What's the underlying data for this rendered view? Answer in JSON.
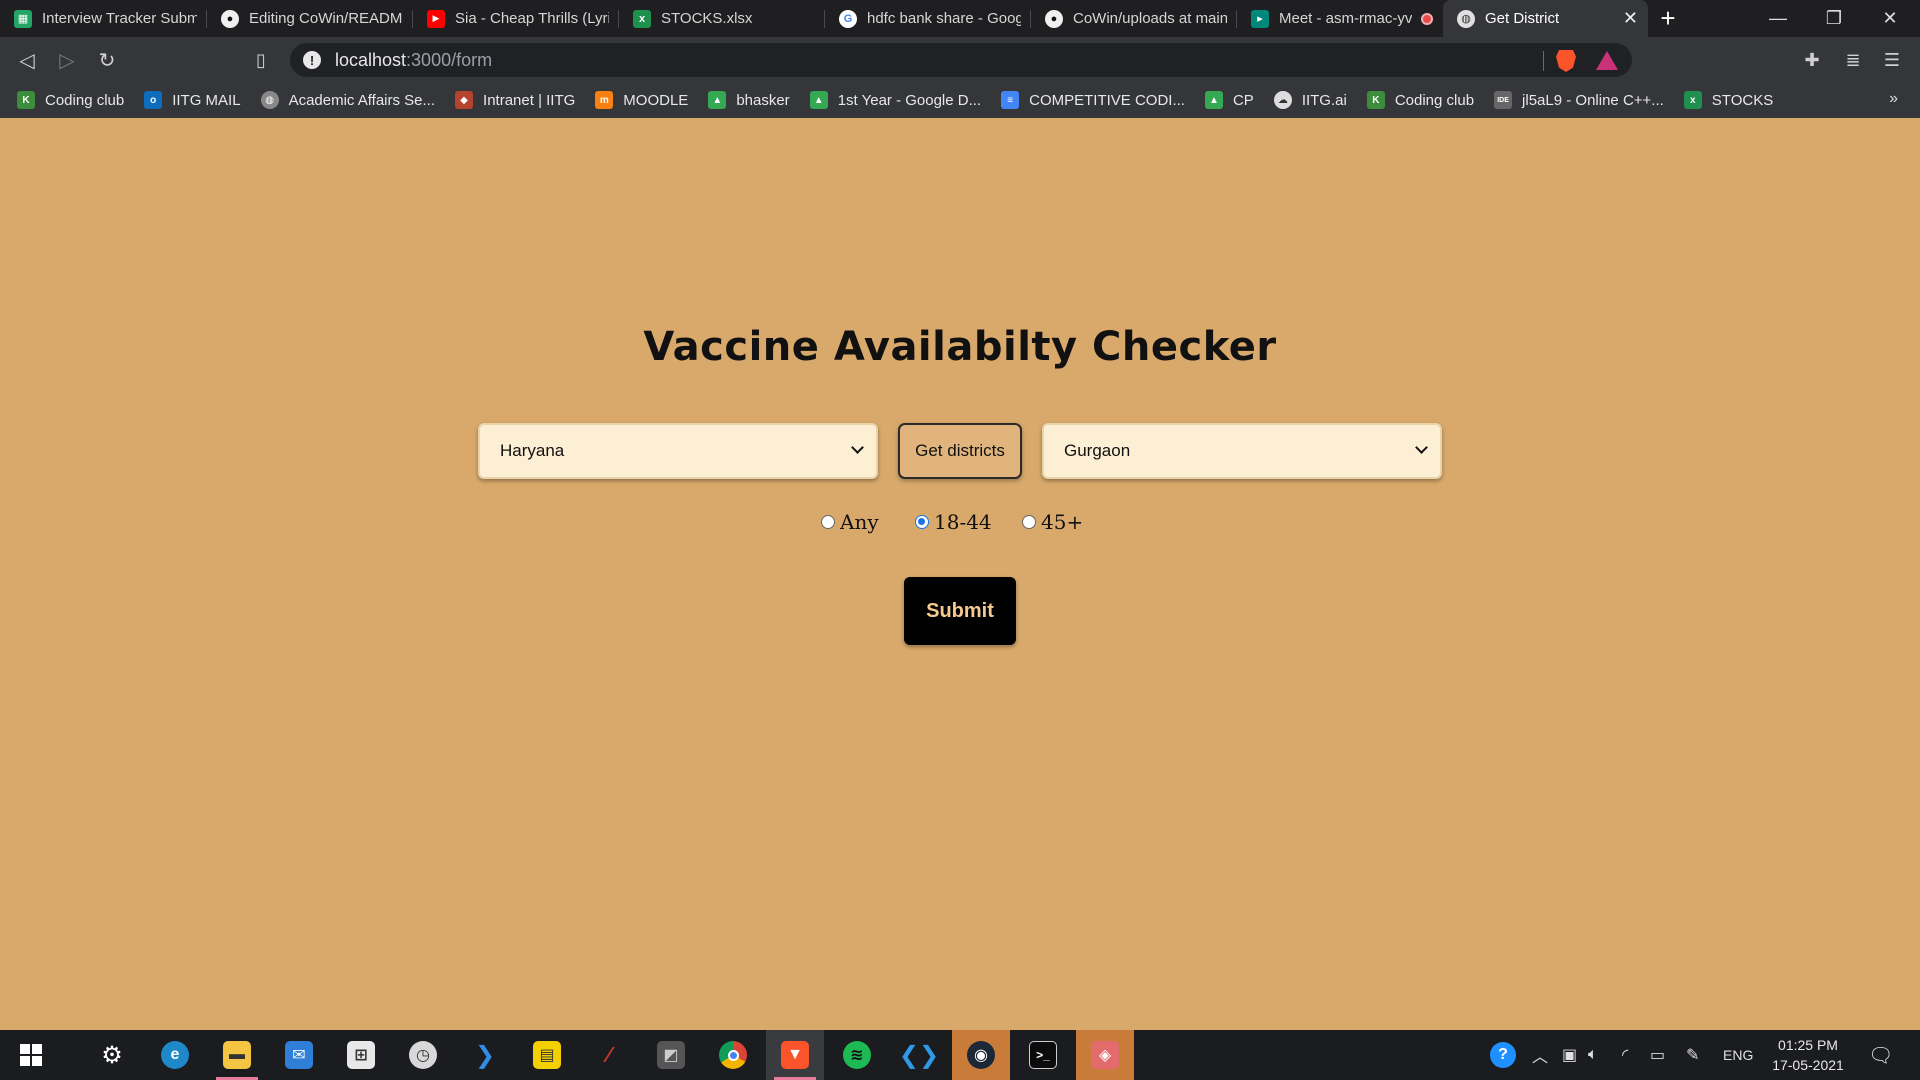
{
  "browser": {
    "tabs": [
      {
        "title": "Interview Tracker Submi",
        "icon": "sheets-icon",
        "color": "#23a566"
      },
      {
        "title": "Editing CoWin/README",
        "icon": "github-icon",
        "color": "#f0f0f0"
      },
      {
        "title": "Sia - Cheap Thrills (Lyric",
        "icon": "youtube-icon",
        "color": "#ff0000"
      },
      {
        "title": "STOCKS.xlsx",
        "icon": "excel-icon",
        "color": "#1f8f4e"
      },
      {
        "title": "hdfc bank share - Googl",
        "icon": "google-icon",
        "color": "#ffffff"
      },
      {
        "title": "CoWin/uploads at main",
        "icon": "github-icon",
        "color": "#f0f0f0"
      },
      {
        "title": "Meet - asm-rmac-yv",
        "icon": "meet-icon",
        "color": "#00897b"
      },
      {
        "title": "Get District",
        "icon": "globe-icon",
        "color": "#e0e0e0",
        "active": true
      }
    ],
    "new_tab_glyph": "+",
    "url": {
      "host": "localhost",
      "path": ":3000/form"
    }
  },
  "bookmarks": [
    {
      "label": "Coding club",
      "icon": "coding-club-icon",
      "color": "#3c8d3c"
    },
    {
      "label": "IITG MAIL",
      "icon": "outlook-icon",
      "color": "#0f6cbd"
    },
    {
      "label": "Academic Affairs Se...",
      "icon": "globe-icon",
      "color": "#888888"
    },
    {
      "label": "Intranet | IITG",
      "icon": "iitg-icon",
      "color": "#b5442f"
    },
    {
      "label": "MOODLE",
      "icon": "moodle-icon",
      "color": "#f98012"
    },
    {
      "label": "bhasker",
      "icon": "drive-icon",
      "color": "#34a853"
    },
    {
      "label": "1st Year - Google D...",
      "icon": "drive-icon",
      "color": "#34a853"
    },
    {
      "label": "COMPETITIVE CODI...",
      "icon": "docs-icon",
      "color": "#4285f4"
    },
    {
      "label": "CP",
      "icon": "drive-icon",
      "color": "#34a853"
    },
    {
      "label": "IITG.ai",
      "icon": "brain-icon",
      "color": "#dddddd"
    },
    {
      "label": "Coding club",
      "icon": "coding-club-icon",
      "color": "#3c8d3c"
    },
    {
      "label": "jl5aL9 - Online C++...",
      "icon": "ideone-icon",
      "color": "#666666"
    },
    {
      "label": "STOCKS",
      "icon": "excel-icon",
      "color": "#1f8f4e"
    }
  ],
  "bookmarks_more": "»",
  "page": {
    "title": "Vaccine Availabilty Checker",
    "state_select": {
      "value": "Haryana"
    },
    "get_districts_label": "Get districts",
    "district_select": {
      "value": "Gurgaon"
    },
    "age_options": [
      {
        "label": "Any",
        "checked": false
      },
      {
        "label": "18-44",
        "checked": true
      },
      {
        "label": "45+",
        "checked": false
      }
    ],
    "submit_label": "Submit"
  },
  "taskbar": {
    "language": "ENG",
    "time": "01:25 PM",
    "date": "17-05-2021"
  }
}
